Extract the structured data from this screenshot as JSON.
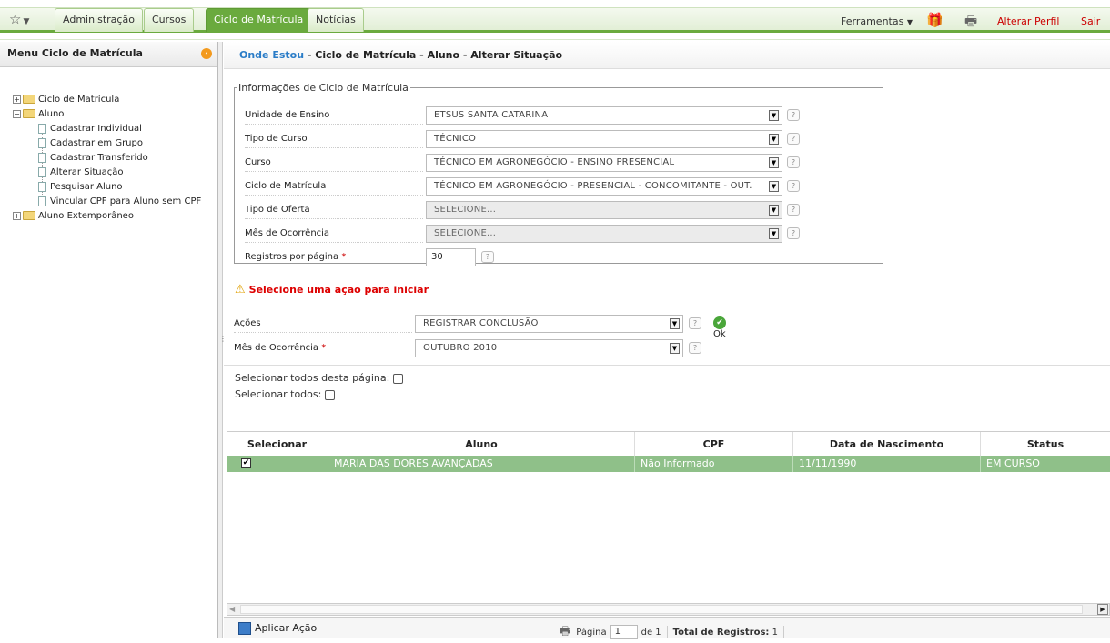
{
  "nav": {
    "tabs": [
      "Administração",
      "Cursos",
      "Ciclo de Matrícula",
      "Notícias"
    ],
    "tools": "Ferramentas",
    "alterar_perfil": "Alterar Perfil",
    "sair": "Sair"
  },
  "sidebar": {
    "title": "Menu Ciclo de Matrícula",
    "items": [
      {
        "label": "Ciclo de Matrícula"
      },
      {
        "label": "Aluno"
      },
      {
        "label": "Cadastrar Individual"
      },
      {
        "label": "Cadastrar em Grupo"
      },
      {
        "label": "Cadastrar Transferido"
      },
      {
        "label": "Alterar Situação"
      },
      {
        "label": "Pesquisar Aluno"
      },
      {
        "label": "Vincular CPF para Aluno sem CPF"
      },
      {
        "label": "Aluno Extemporâneo"
      }
    ]
  },
  "breadcrumb": {
    "here": "Onde Estou",
    "path": " - Ciclo de Matrícula - Aluno - Alterar Situação"
  },
  "info": {
    "legend": "Informações de Ciclo de Matrícula",
    "fields": [
      {
        "label": "Unidade de Ensino",
        "value": "ETSUS SANTA CATARINA"
      },
      {
        "label": "Tipo de Curso",
        "value": "TÉCNICO"
      },
      {
        "label": "Curso",
        "value": "TÉCNICO EM AGRONEGÓCIO - ENSINO PRESENCIAL"
      },
      {
        "label": "Ciclo de Matrícula",
        "value": "TÉCNICO EM AGRONEGÓCIO - PRESENCIAL - CONCOMITANTE - OUT."
      },
      {
        "label": "Tipo de Oferta",
        "value": "SELECIONE..."
      },
      {
        "label": "Mês de Ocorrência",
        "value": "SELECIONE..."
      },
      {
        "label": "Registros por página",
        "value": "30"
      }
    ]
  },
  "warning": "Selecione uma ação para iniciar",
  "actions": {
    "acoes_label": "Ações",
    "acoes_value": "REGISTRAR CONCLUSÃO",
    "ok_label": "Ok",
    "mes_label": "Mês de Ocorrência",
    "mes_value": "OUTUBRO 2010"
  },
  "select_page_label": "Selecionar todos desta página:",
  "select_all_label": "Selecionar todos:",
  "table": {
    "headers": [
      "Selecionar",
      "Aluno",
      "CPF",
      "Data de Nascimento",
      "Status"
    ],
    "rows": [
      {
        "aluno": "MARIA DAS DORES AVANÇADAS",
        "cpf": "Não Informado",
        "nascimento": "11/11/1990",
        "status": "EM CURSO",
        "selected": true
      }
    ]
  },
  "footer": {
    "apply_label": "Aplicar Ação",
    "pagina_label": "Página",
    "pagina_value": "1",
    "de_label": "de 1",
    "total_label": "Total de Registros:",
    "total_value": "1"
  }
}
